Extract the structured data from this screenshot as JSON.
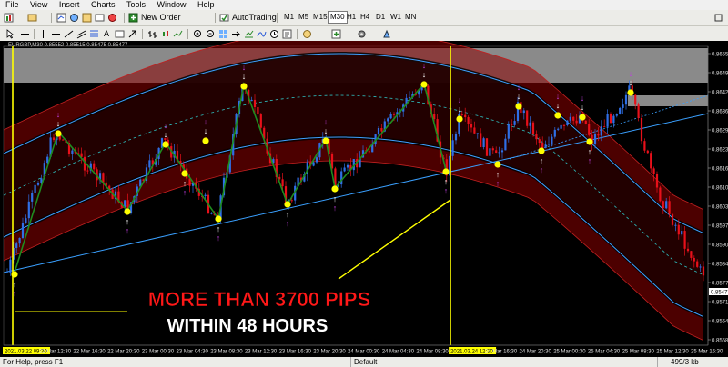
{
  "menu": {
    "items": [
      "File",
      "View",
      "Insert",
      "Charts",
      "Tools",
      "Window",
      "Help"
    ]
  },
  "toolbar": {
    "new_order": "New Order",
    "autotrading": "AutoTrading",
    "timeframes": [
      "M1",
      "M5",
      "M15",
      "M30",
      "H1",
      "H4",
      "D1",
      "W1",
      "MN"
    ],
    "active_timeframe": "M30"
  },
  "chart": {
    "header": "EURGBP,M30  0.85552 0.85515 0.85475 0.85477",
    "price_labels": [
      "0.86555",
      "0.86490",
      "0.86425",
      "0.86360",
      "0.86295",
      "0.86230",
      "0.86165",
      "0.86100",
      "0.86035",
      "0.85970",
      "0.85905",
      "0.85840",
      "0.85775",
      "0.85710",
      "0.85645",
      "0.85580"
    ],
    "price_highlight": "0.85477",
    "time_labels": [
      "2021.03.22 09:30",
      "22 Mar 12:30",
      "22 Mar 16:30",
      "22 Mar 20:30",
      "23 Mar 00:30",
      "23 Mar 04:30",
      "23 Mar 08:30",
      "23 Mar 12:30",
      "23 Mar 16:30",
      "23 Mar 20:30",
      "24 Mar 00:30",
      "24 Mar 04:30",
      "24 Mar 08:30",
      "2021.03.24 12:30",
      "24 Mar 16:30",
      "24 Mar 20:30",
      "25 Mar 00:30",
      "25 Mar 04:30",
      "25 Mar 08:30",
      "25 Mar 12:30",
      "25 Mar 16:30"
    ],
    "overlay_line1": "MORE THAN 3700 PIPS",
    "overlay_line2": "WITHIN 48 HOURS",
    "colors": {
      "bull": "#2f6fe6",
      "bear": "#e8101a",
      "zigzag": "#1f8c1f",
      "signal": "#ffff00",
      "band": "#8a0000",
      "channel": "#3fa0ff",
      "marker_up": "#ffffff",
      "marker_down": "#c040e0"
    }
  },
  "status": {
    "help": "For Help, press F1",
    "profile": "Default",
    "traffic": "499/3 kb"
  }
}
